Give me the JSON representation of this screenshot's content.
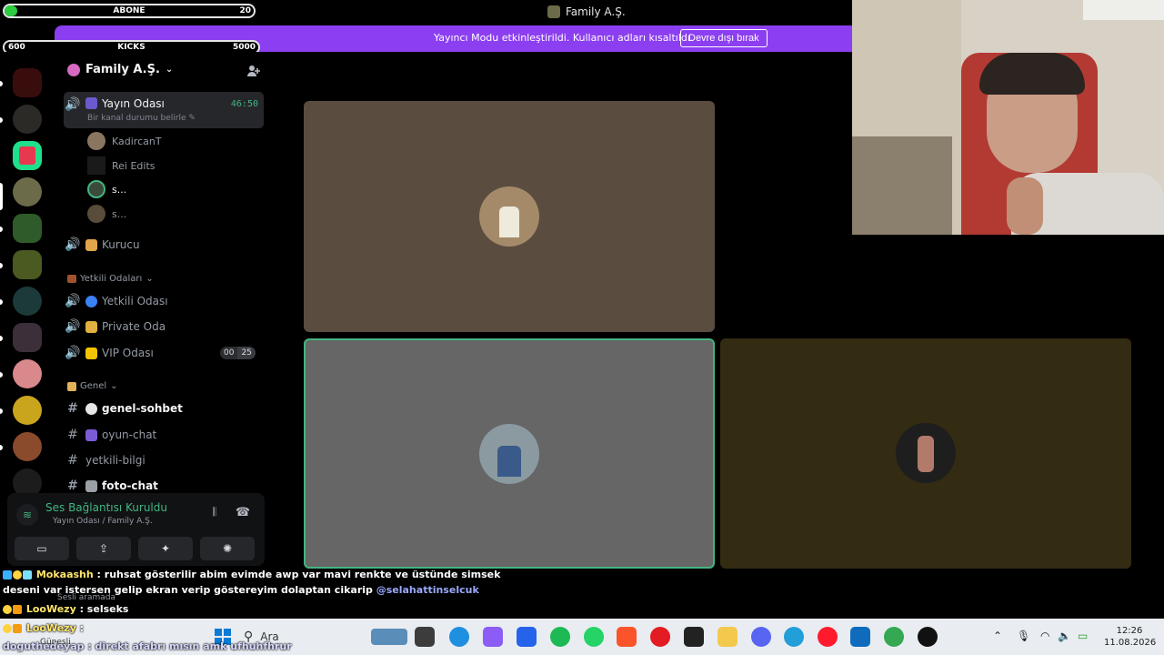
{
  "window": {
    "title": "Family A.Ş."
  },
  "overlay": {
    "subs": {
      "label": "ABONE",
      "current": "",
      "target": "20",
      "progress": 0.05
    },
    "kicks": {
      "label": "KICKS",
      "current": "600",
      "target": "5000",
      "progress": 0.12
    }
  },
  "notice": {
    "text": "Yayıncı Modu etkinleştirildi. Kullanıcı adları kısaltıldı.",
    "button": "Devre dışı bırak"
  },
  "guild": {
    "name": "Family A.Ş."
  },
  "channels": {
    "active": {
      "name": "Yayın Odası",
      "timer": "46:50",
      "status": "Bir kanal durumu belirle"
    },
    "users": [
      "KadircanT",
      "Rei Edits",
      "s...",
      "s..."
    ],
    "kurucu": "Kurucu",
    "cat_yetkili": "Yetkili Odaları",
    "yetkili_odasi": "Yetkili Odası",
    "private_oda": "Private Oda",
    "vip_odasi": "VIP Odası",
    "vip_count_a": "00",
    "vip_count_b": "25",
    "cat_genel": "Genel",
    "genel_sohbet": "genel-sohbet",
    "oyun_chat": "oyun-chat",
    "yetkili_bilgi": "yetkili-bilgi",
    "foto_chat": "foto-chat"
  },
  "voice": {
    "title": "Ses Bağlantısı Kuruldu",
    "sub": "Yayın Odası / Family A.Ş."
  },
  "chat": [
    {
      "user": "Mokaashh",
      "text": " : ruhsat gösterilir abim evimde awp var mavi renkte ve üstünde simsek"
    },
    {
      "user": "",
      "text": "deseni var istersen gelip ekran verip göstereyim dolaptan cikarip ",
      "mention": "@selahattinselcuk"
    },
    {
      "user": "LooWezy",
      "text": " : selseks"
    },
    {
      "user": "LooWezy",
      "text": " :"
    },
    {
      "user": "",
      "text": "doguthedeyap : direkt afabrı mısın amk ufhuhfhrur"
    }
  ],
  "background_text": {
    "sesli": "Sesli aramada",
    "gunesli": "Güneşli"
  },
  "taskbar": {
    "search_placeholder": "Ara",
    "time": "12:26",
    "date": "11.08.2026"
  },
  "colors": {
    "accent_purple": "#8c3ff0",
    "speaking_green": "#43b581"
  }
}
